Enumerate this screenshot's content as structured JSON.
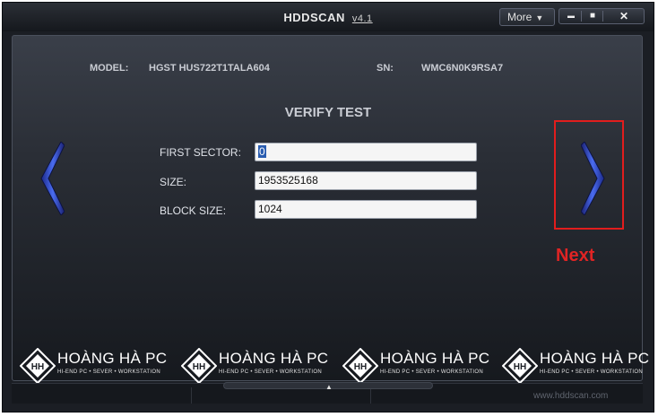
{
  "window": {
    "title": "HDDSCAN",
    "version": "v4.1",
    "more_label": "More",
    "controls": {
      "minimize": "▬",
      "maximize": "■",
      "close": "✕"
    }
  },
  "drive": {
    "model_label": "MODEL:",
    "model": "HGST HUS722T1TALA604",
    "sn_label": "SN:",
    "sn": "WMC6N0K9RSA7"
  },
  "test": {
    "title": "VERIFY TEST",
    "fields": [
      {
        "label": "FIRST SECTOR:",
        "value": "0"
      },
      {
        "label": "SIZE:",
        "value": "1953525168"
      },
      {
        "label": "BLOCK SIZE:",
        "value": "1024"
      }
    ]
  },
  "annotation": {
    "next_label": "Next",
    "color": "#e02424"
  },
  "watermark": {
    "name": "HOÀNG HÀ PC",
    "tagline": "HI-END PC • SEVER • WORKSTATION",
    "count": 4
  },
  "status": {
    "url": "www.hddscan.com"
  }
}
